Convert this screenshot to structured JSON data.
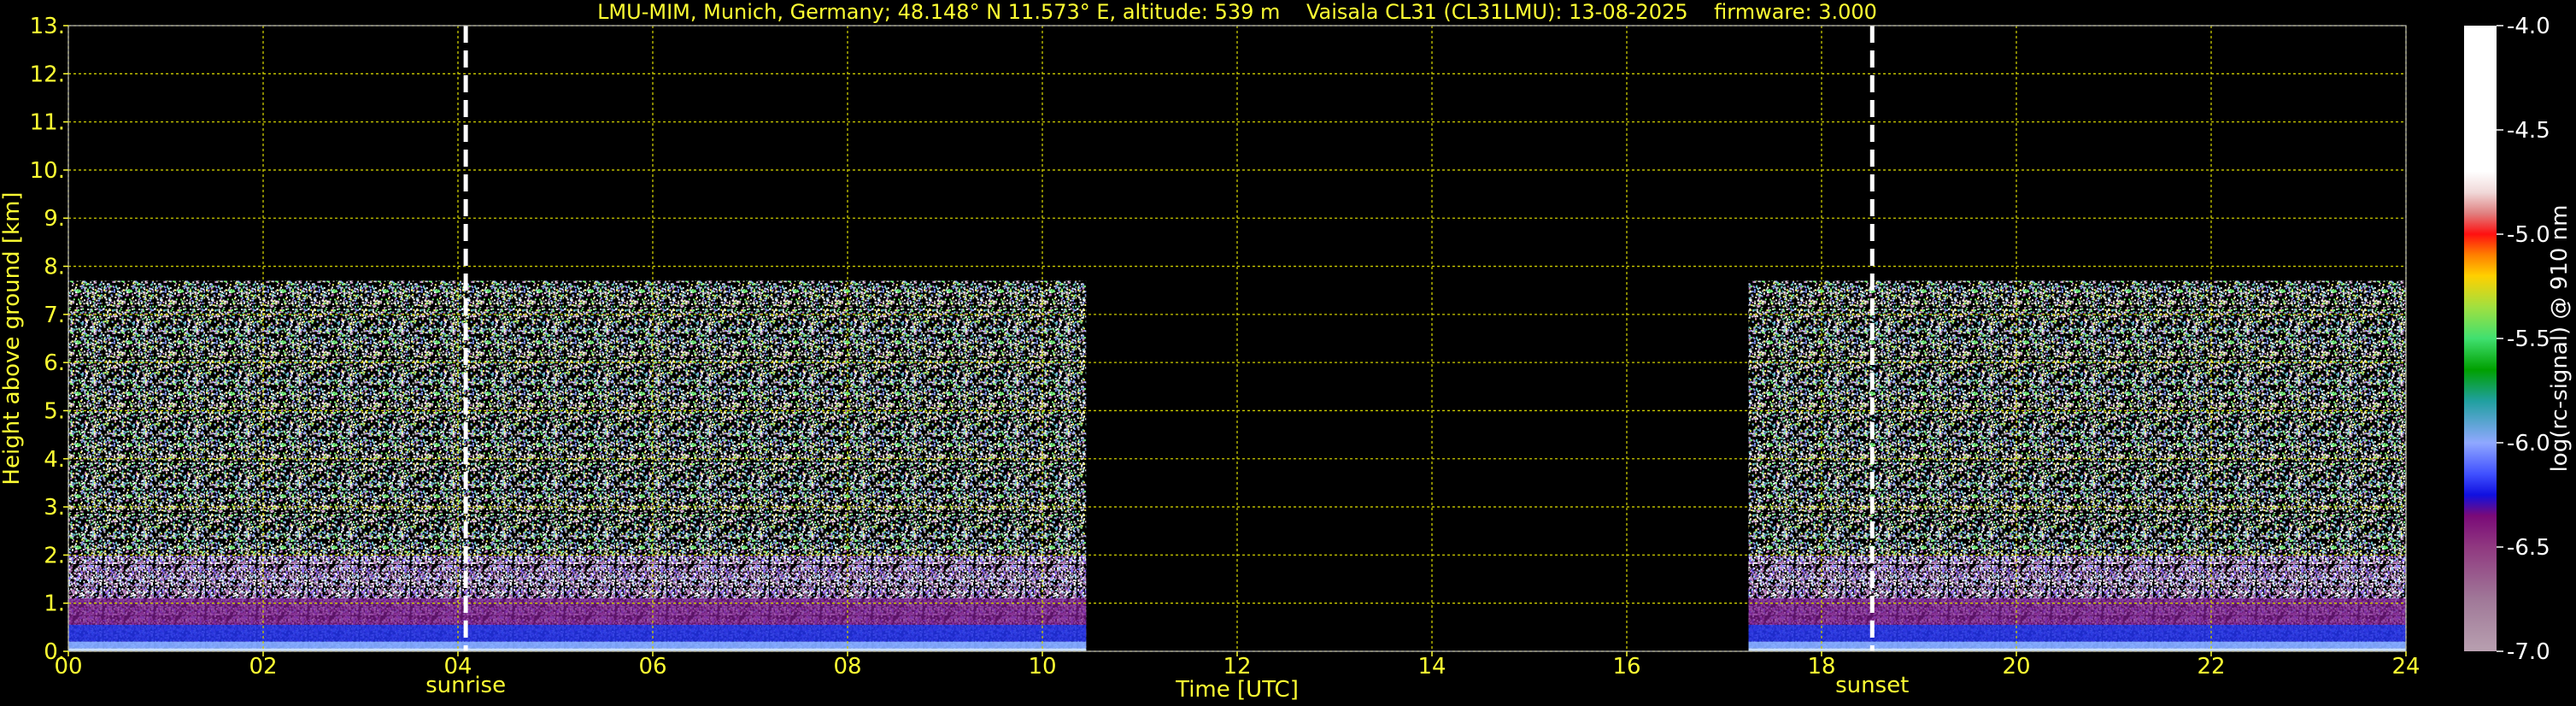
{
  "header": {
    "title": "LMU-MIM, Munich, Germany; 48.148° N 11.573° E, altitude: 539 m    Vaisala CL31 (CL31LMU): 13-08-2025    firmware: 3.000"
  },
  "colors": {
    "text": "#ffff33",
    "grid": "#cccc00",
    "background": "#000000",
    "marker_line": "#ffffff"
  },
  "chart_data": {
    "type": "heatmap",
    "title": "LMU-MIM, Munich, Germany; 48.148° N 11.573° E, altitude: 539 m    Vaisala CL31 (CL31LMU): 13-08-2025    firmware: 3.000",
    "xlabel": "Time [UTC]",
    "ylabel": "Height above ground [km]",
    "xlim": [
      0,
      24
    ],
    "ylim": [
      0,
      13
    ],
    "x_ticks": [
      "00",
      "02",
      "04",
      "06",
      "08",
      "10",
      "12",
      "14",
      "16",
      "18",
      "20",
      "22",
      "24"
    ],
    "y_ticks": [
      "0.",
      "1.",
      "2.",
      "3.",
      "4.",
      "5.",
      "6.",
      "7.",
      "8.",
      "9.",
      "10.",
      "11.",
      "12.",
      "13."
    ],
    "grid": true,
    "data_segments": [
      {
        "start_hour": 0.0,
        "end_hour": 10.45,
        "max_height_km": 7.7
      },
      {
        "start_hour": 17.25,
        "end_hour": 24.0,
        "max_height_km": 7.7
      }
    ],
    "markers": [
      {
        "label": "sunrise",
        "hour": 4.08
      },
      {
        "label": "sunset",
        "hour": 18.52
      }
    ],
    "colorbar": {
      "label": "log(rc-signal) @ 910 nm",
      "range": [
        -7.0,
        -4.0
      ],
      "ticks": [
        "-4.0",
        "-4.5",
        "-5.0",
        "-5.5",
        "-6.0",
        "-6.5",
        "-7.0"
      ],
      "color_stops": [
        {
          "value": -7.0,
          "color": "#b8a0b0"
        },
        {
          "value": -6.75,
          "color": "#a07898"
        },
        {
          "value": -6.5,
          "color": "#903880"
        },
        {
          "value": -6.35,
          "color": "#7a0a78"
        },
        {
          "value": -6.25,
          "color": "#1010e0"
        },
        {
          "value": -6.15,
          "color": "#4050ff"
        },
        {
          "value": -6.0,
          "color": "#90a8ff"
        },
        {
          "value": -5.8,
          "color": "#20a0a0"
        },
        {
          "value": -5.65,
          "color": "#00a000"
        },
        {
          "value": -5.5,
          "color": "#40e070"
        },
        {
          "value": -5.35,
          "color": "#a0e040"
        },
        {
          "value": -5.2,
          "color": "#ffd000"
        },
        {
          "value": -5.1,
          "color": "#ff8000"
        },
        {
          "value": -5.0,
          "color": "#ff1010"
        },
        {
          "value": -4.9,
          "color": "#e08080"
        },
        {
          "value": -4.8,
          "color": "#f0d8d8"
        },
        {
          "value": -4.7,
          "color": "#ffffff"
        },
        {
          "value": -4.0,
          "color": "#ffffff"
        }
      ]
    }
  }
}
